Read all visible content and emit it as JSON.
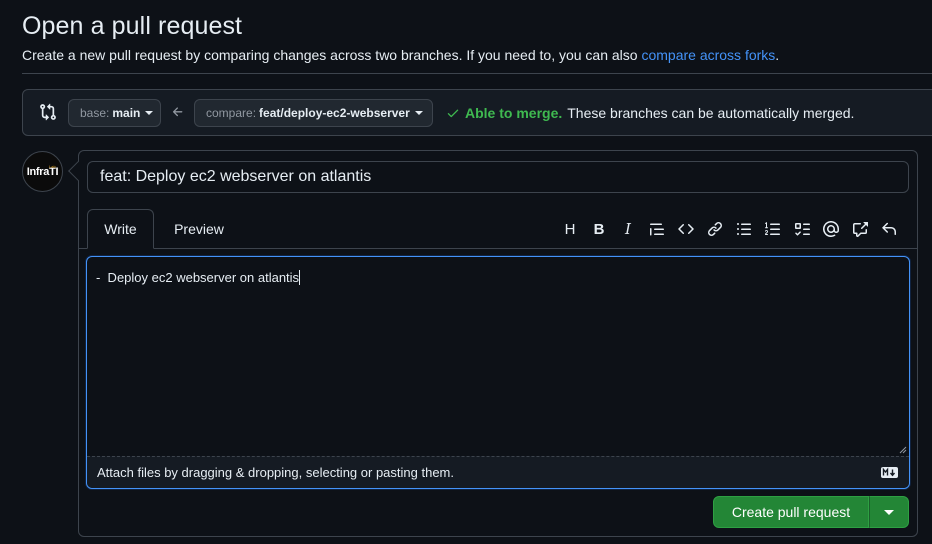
{
  "page": {
    "title": "Open a pull request",
    "subtitle": "Create a new pull request by comparing changes across two branches. If you need to, you can also",
    "subtitle_link": "compare across forks",
    "subtitle_end": "."
  },
  "compare": {
    "base_prefix": "base:",
    "base_branch": "main",
    "compare_prefix": "compare:",
    "compare_branch": "feat/deploy-ec2-webserver",
    "merge_status": "Able to merge.",
    "merge_description": "These branches can be automatically merged."
  },
  "avatar": {
    "text": "InfraTI",
    "small_text": "Lab"
  },
  "form": {
    "title_value": "feat: Deploy ec2 webserver on atlantis",
    "tabs": [
      {
        "label": "Write",
        "active": true
      },
      {
        "label": "Preview",
        "active": false
      }
    ],
    "toolbar": {
      "heading": "H",
      "bold": "B",
      "italic": "I"
    },
    "body_value": "-  Deploy ec2 webserver on atlantis",
    "attach_text": "Attach files by dragging & dropping, selecting or pasting them.",
    "submit_label": "Create pull request"
  },
  "icons": {
    "compare": "git-compare-icon",
    "arrow": "arrow-left-icon",
    "check": "check-icon",
    "markdown": "markdown-icon"
  },
  "colors": {
    "background": "#0d1117",
    "accent": "#4493f8",
    "success": "#3fb950",
    "primary_button": "#238636"
  }
}
